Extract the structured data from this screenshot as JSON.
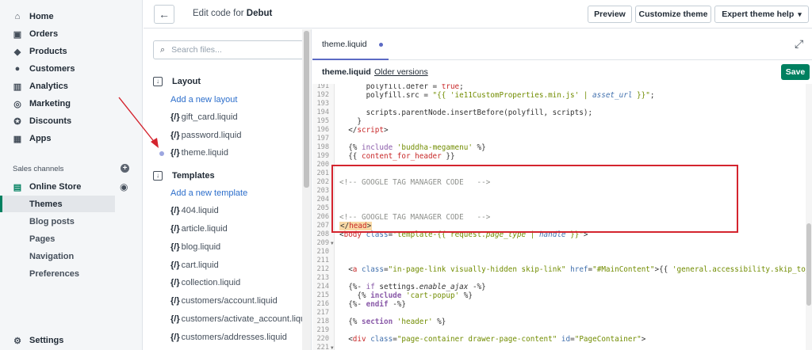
{
  "nav": {
    "items": [
      {
        "label": "Home",
        "icon": "home-icon"
      },
      {
        "label": "Orders",
        "icon": "orders-icon"
      },
      {
        "label": "Products",
        "icon": "tag-icon"
      },
      {
        "label": "Customers",
        "icon": "person-icon"
      },
      {
        "label": "Analytics",
        "icon": "bar-chart-icon"
      },
      {
        "label": "Marketing",
        "icon": "target-icon"
      },
      {
        "label": "Discounts",
        "icon": "discount-icon"
      },
      {
        "label": "Apps",
        "icon": "apps-icon"
      }
    ],
    "sales_channels_label": "Sales channels",
    "online_store": {
      "label": "Online Store",
      "icon": "store-icon"
    },
    "sub_items": [
      "Themes",
      "Blog posts",
      "Pages",
      "Navigation",
      "Preferences"
    ],
    "settings": {
      "label": "Settings",
      "icon": "gear-icon"
    }
  },
  "topbar": {
    "title_prefix": "Edit code for",
    "theme_name": "Debut",
    "preview_label": "Preview",
    "customize_label": "Customize theme",
    "expert_label": "Expert theme help",
    "expert_caret": "▾"
  },
  "files": {
    "search_placeholder": "Search files...",
    "layout_label": "Layout",
    "add_layout": "Add a new layout",
    "layout_files": [
      "gift_card.liquid",
      "password.liquid",
      "theme.liquid"
    ],
    "templates_label": "Templates",
    "add_template": "Add a new template",
    "template_files": [
      "404.liquid",
      "article.liquid",
      "blog.liquid",
      "cart.liquid",
      "collection.liquid",
      "customers/account.liquid",
      "customers/activate_account.liquid",
      "customers/addresses.liquid"
    ]
  },
  "editor": {
    "tab_label": "theme.liquid",
    "file_name": "theme.liquid",
    "older_versions": "Older versions",
    "save_label": "Save",
    "line_numbers": [
      "191",
      "192",
      "193",
      "194",
      "195",
      "196",
      "197",
      "198",
      "199",
      "200",
      "201",
      "202",
      "203",
      "204",
      "205",
      "206",
      "207",
      "208",
      "209",
      "210",
      "211",
      "212",
      "213",
      "214",
      "215",
      "216",
      "217",
      "218",
      "219",
      "220",
      "221"
    ]
  },
  "colors": {
    "accent_green": "#008060",
    "link_blue": "#2c6ecb",
    "annotation_red": "#d4242e",
    "tab_indicator": "#5c6ac4"
  }
}
